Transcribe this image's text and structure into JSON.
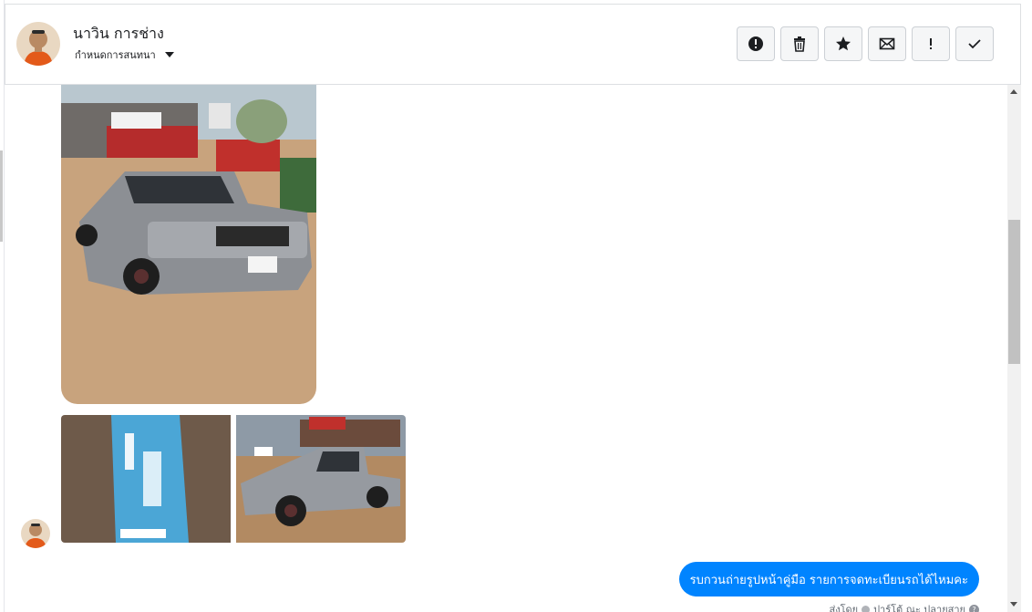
{
  "header": {
    "contact_name": "นาวิน การช่าง",
    "assign_label": "กำหนดการสนทนา"
  },
  "toolbar": {
    "buttons": [
      {
        "icon": "alert-circle-icon",
        "label": "spam"
      },
      {
        "icon": "trash-icon",
        "label": "delete"
      },
      {
        "icon": "star-icon",
        "label": "star"
      },
      {
        "icon": "envelope-icon",
        "label": "mark-unread"
      },
      {
        "icon": "exclamation-icon",
        "label": "follow-up"
      },
      {
        "icon": "checkmark-icon",
        "label": "done"
      }
    ]
  },
  "messages": {
    "outgoing_text": "รบกวนถ่ายรูปหน้าคู่มือ รายการจดทะเบียนรถได้ไหมคะ",
    "sent_by_label": "ส่งโดย",
    "sent_by_name": "ปาร์โต้ ณะ ปลายสาย"
  },
  "colors": {
    "bubble": "#0084ff",
    "header_border": "#dddfe2"
  }
}
